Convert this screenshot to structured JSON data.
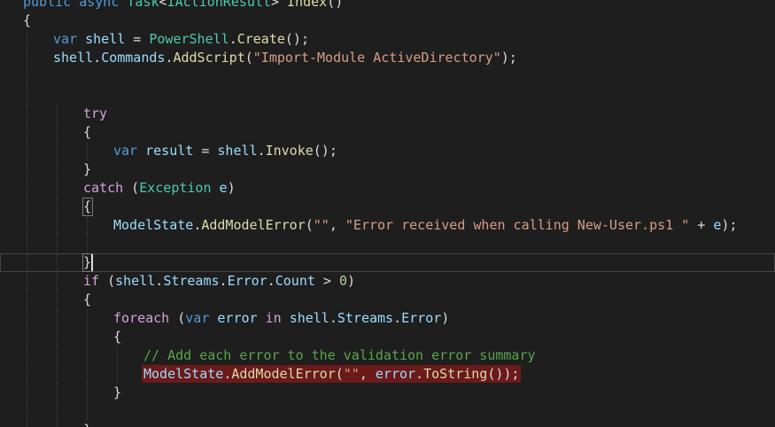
{
  "editor": {
    "colors": {
      "background": "#1e1e1e",
      "keyword": "#569cd6",
      "control": "#d8a0df",
      "type": "#4ec9b0",
      "method": "#dcdcaa",
      "variable": "#9cdcfe",
      "string": "#d69d85",
      "comment": "#57a64a",
      "number": "#b5cea8",
      "text": "#dcdcdc",
      "error_bg": "#6b1a1a"
    },
    "lines": [
      {
        "indent": 0,
        "tokens": [
          {
            "t": "public",
            "c": "keyword"
          },
          {
            "t": " "
          },
          {
            "t": "async",
            "c": "keyword"
          },
          {
            "t": " "
          },
          {
            "t": "Task",
            "c": "type"
          },
          {
            "t": "<"
          },
          {
            "t": "IActionResult",
            "c": "type"
          },
          {
            "t": "> "
          },
          {
            "t": "Index",
            "c": "method"
          },
          {
            "t": "()"
          }
        ]
      },
      {
        "indent": 0,
        "tokens": [
          {
            "t": "{"
          }
        ]
      },
      {
        "indent": 1,
        "tokens": [
          {
            "t": "var",
            "c": "keyword"
          },
          {
            "t": " "
          },
          {
            "t": "shell",
            "c": "variable"
          },
          {
            "t": " = "
          },
          {
            "t": "PowerShell",
            "c": "type"
          },
          {
            "t": "."
          },
          {
            "t": "Create",
            "c": "method"
          },
          {
            "t": "();"
          }
        ]
      },
      {
        "indent": 1,
        "tokens": [
          {
            "t": "shell",
            "c": "variable"
          },
          {
            "t": "."
          },
          {
            "t": "Commands",
            "c": "variable"
          },
          {
            "t": "."
          },
          {
            "t": "AddScript",
            "c": "method"
          },
          {
            "t": "("
          },
          {
            "t": "\"Import-Module ActiveDirectory\"",
            "c": "string"
          },
          {
            "t": ");"
          }
        ]
      },
      {
        "indent": 1,
        "tokens": []
      },
      {
        "indent": 1,
        "tokens": []
      },
      {
        "indent": 2,
        "tokens": [
          {
            "t": "try",
            "c": "control"
          }
        ]
      },
      {
        "indent": 2,
        "tokens": [
          {
            "t": "{"
          }
        ]
      },
      {
        "indent": 3,
        "tokens": [
          {
            "t": "var",
            "c": "keyword"
          },
          {
            "t": " "
          },
          {
            "t": "result",
            "c": "variable"
          },
          {
            "t": " = "
          },
          {
            "t": "shell",
            "c": "variable"
          },
          {
            "t": "."
          },
          {
            "t": "Invoke",
            "c": "method"
          },
          {
            "t": "();"
          }
        ]
      },
      {
        "indent": 2,
        "tokens": [
          {
            "t": "}"
          }
        ]
      },
      {
        "indent": 2,
        "tokens": [
          {
            "t": "catch",
            "c": "control"
          },
          {
            "t": " ("
          },
          {
            "t": "Exception",
            "c": "type"
          },
          {
            "t": " "
          },
          {
            "t": "e",
            "c": "variable"
          },
          {
            "t": ")"
          }
        ]
      },
      {
        "indent": 2,
        "brace_match": true,
        "tokens": [
          {
            "t": "{"
          }
        ]
      },
      {
        "indent": 3,
        "tokens": [
          {
            "t": "ModelState",
            "c": "variable"
          },
          {
            "t": "."
          },
          {
            "t": "AddModelError",
            "c": "method"
          },
          {
            "t": "("
          },
          {
            "t": "\"\"",
            "c": "string"
          },
          {
            "t": ", "
          },
          {
            "t": "\"Error received when calling New-User.ps1 \"",
            "c": "string"
          },
          {
            "t": " + "
          },
          {
            "t": "e",
            "c": "variable"
          },
          {
            "t": ");"
          }
        ]
      },
      {
        "indent": 3,
        "tokens": []
      },
      {
        "indent": 2,
        "current": true,
        "brace_match": true,
        "caret": true,
        "tokens": [
          {
            "t": "}"
          }
        ]
      },
      {
        "indent": 2,
        "tokens": [
          {
            "t": "if",
            "c": "control"
          },
          {
            "t": " ("
          },
          {
            "t": "shell",
            "c": "variable"
          },
          {
            "t": "."
          },
          {
            "t": "Streams",
            "c": "variable"
          },
          {
            "t": "."
          },
          {
            "t": "Error",
            "c": "variable"
          },
          {
            "t": "."
          },
          {
            "t": "Count",
            "c": "variable"
          },
          {
            "t": " > "
          },
          {
            "t": "0",
            "c": "number"
          },
          {
            "t": ")"
          }
        ]
      },
      {
        "indent": 2,
        "tokens": [
          {
            "t": "{"
          }
        ]
      },
      {
        "indent": 3,
        "tokens": [
          {
            "t": "foreach",
            "c": "control"
          },
          {
            "t": " ("
          },
          {
            "t": "var",
            "c": "keyword"
          },
          {
            "t": " "
          },
          {
            "t": "error",
            "c": "variable"
          },
          {
            "t": " "
          },
          {
            "t": "in",
            "c": "control"
          },
          {
            "t": " "
          },
          {
            "t": "shell",
            "c": "variable"
          },
          {
            "t": "."
          },
          {
            "t": "Streams",
            "c": "variable"
          },
          {
            "t": "."
          },
          {
            "t": "Error",
            "c": "variable"
          },
          {
            "t": ")"
          }
        ]
      },
      {
        "indent": 3,
        "tokens": [
          {
            "t": "{"
          }
        ]
      },
      {
        "indent": 4,
        "tokens": [
          {
            "t": "// Add each error to the validation error summary",
            "c": "comment"
          }
        ]
      },
      {
        "indent": 4,
        "error": true,
        "tokens": [
          {
            "t": "ModelState",
            "c": "variable"
          },
          {
            "t": "."
          },
          {
            "t": "AddModelError",
            "c": "method"
          },
          {
            "t": "("
          },
          {
            "t": "\"\"",
            "c": "string"
          },
          {
            "t": ", "
          },
          {
            "t": "error",
            "c": "variable"
          },
          {
            "t": "."
          },
          {
            "t": "ToString",
            "c": "method"
          },
          {
            "t": "());"
          }
        ]
      },
      {
        "indent": 3,
        "tokens": [
          {
            "t": "}"
          }
        ]
      },
      {
        "indent": 3,
        "tokens": []
      },
      {
        "indent": 2,
        "tokens": [
          {
            "t": "}"
          }
        ]
      }
    ]
  }
}
